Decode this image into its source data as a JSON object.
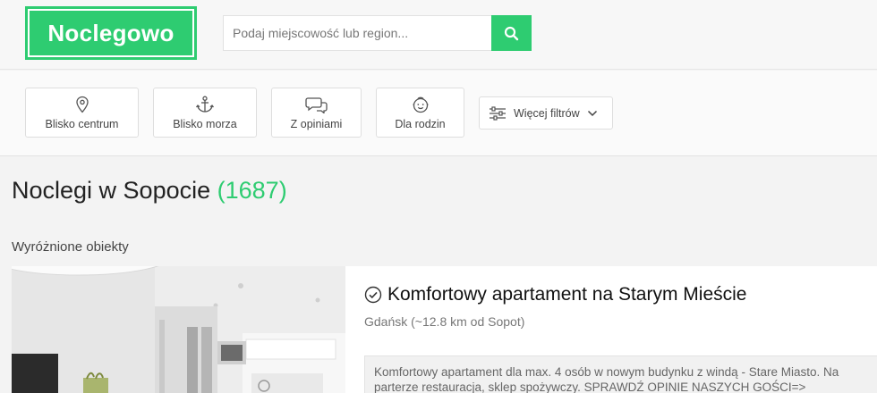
{
  "header": {
    "logo": "Noclegowo",
    "search_placeholder": "Podaj miejscowość lub region...",
    "search_icon": "search-icon"
  },
  "filters": {
    "items": [
      {
        "label": "Blisko centrum",
        "icon": "location-pin-icon"
      },
      {
        "label": "Blisko morza",
        "icon": "anchor-icon"
      },
      {
        "label": "Z opiniami",
        "icon": "chat-bubbles-icon"
      },
      {
        "label": "Dla rodzin",
        "icon": "child-face-icon"
      }
    ],
    "more": {
      "label": "Więcej filtrów",
      "icon": "sliders-icon"
    }
  },
  "main": {
    "title": "Noclegi w Sopocie",
    "count": "(1687)",
    "featured_label": "Wyróżnione obiekty"
  },
  "listing": {
    "title": "Komfortowy apartament na Starym Mieście",
    "location": "Gdańsk (~12.8 km od Sopot)",
    "description_line1": "Komfortowy apartament dla max. 4 osób w nowym budynku z windą - Stare Miasto. Na",
    "description_line2": "parterze restauracja, sklep spożywczy. SPRAWDŹ OPINIE NASZYCH GOŚCI=>"
  },
  "colors": {
    "accent": "#2ecc71"
  }
}
